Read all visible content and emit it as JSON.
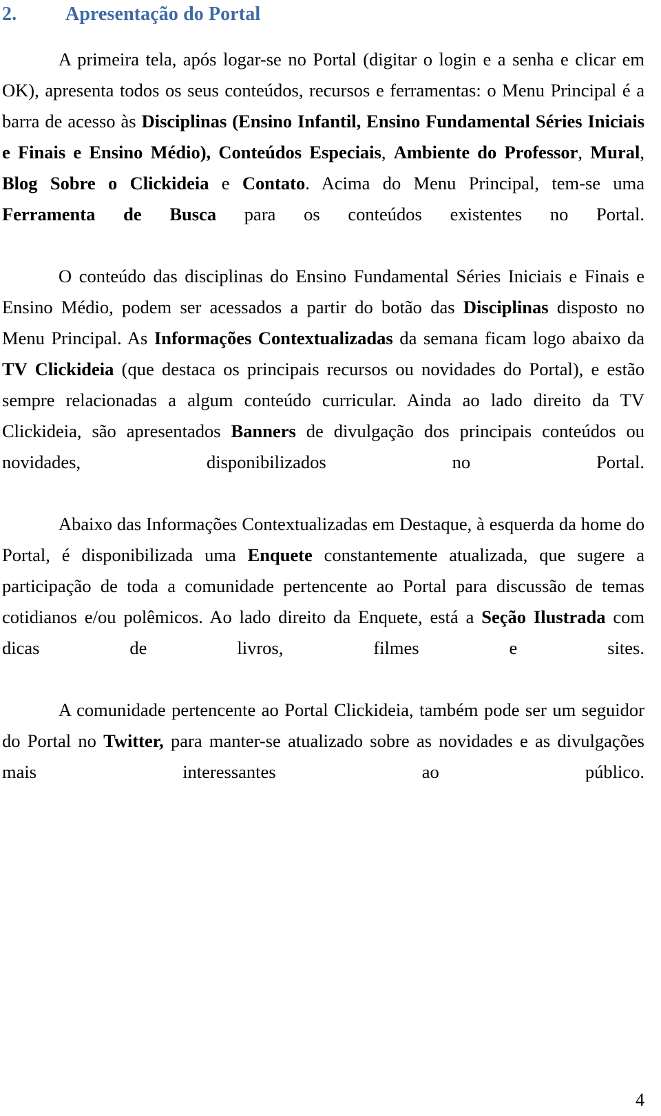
{
  "document": {
    "heading": {
      "number": "2.",
      "title": "Apresentação do Portal",
      "color": "#3f6aa3"
    },
    "paragraphs": [
      {
        "id": "para-1",
        "runs": [
          {
            "text": "A primeira tela, após logar-se no Portal (digitar o login e a senha e clicar em OK), apresenta todos os seus conteúdos, recursos e ferramentas: o Menu Principal é a barra de acesso às ",
            "bold": false
          },
          {
            "text": "Disciplinas (Ensino Infantil, Ensino Fundamental Séries Iniciais e Finais e Ensino Médio), Conteúdos Especiais",
            "bold": true
          },
          {
            "text": ", ",
            "bold": false
          },
          {
            "text": "Ambiente do Professor",
            "bold": true
          },
          {
            "text": ", ",
            "bold": false
          },
          {
            "text": "Mural",
            "bold": true
          },
          {
            "text": ", ",
            "bold": false
          },
          {
            "text": "Blog Sobre o Clickideia",
            "bold": true
          },
          {
            "text": " e ",
            "bold": false
          },
          {
            "text": "Contato",
            "bold": true
          },
          {
            "text": ". Acima do Menu Principal, tem-se uma ",
            "bold": false
          },
          {
            "text": "Ferramenta de Busca",
            "bold": true
          },
          {
            "text": " para os conteúdos existentes no Portal.",
            "bold": false
          }
        ]
      },
      {
        "id": "para-2",
        "runs": [
          {
            "text": "O conteúdo das disciplinas do Ensino Fundamental Séries Iniciais e Finais e Ensino Médio, podem ser acessados a partir do botão das ",
            "bold": false
          },
          {
            "text": "Disciplinas",
            "bold": true
          },
          {
            "text": " disposto no Menu Principal. As ",
            "bold": false
          },
          {
            "text": "Informações Contextualizadas",
            "bold": true
          },
          {
            "text": " da semana ficam logo abaixo da ",
            "bold": false
          },
          {
            "text": "TV Clickideia",
            "bold": true
          },
          {
            "text": " (que destaca os principais recursos ou novidades do Portal), e estão sempre relacionadas a algum conteúdo curricular. Ainda ao lado direito da TV Clickideia, são apresentados ",
            "bold": false
          },
          {
            "text": "Banners",
            "bold": true
          },
          {
            "text": " de divulgação dos principais conteúdos ou novidades, disponibilizados no Portal.",
            "bold": false
          }
        ]
      },
      {
        "id": "para-3",
        "runs": [
          {
            "text": "Abaixo das Informações Contextualizadas em Destaque, à esquerda da home do Portal, é disponibilizada uma ",
            "bold": false
          },
          {
            "text": "Enquete",
            "bold": true
          },
          {
            "text": " constantemente atualizada, que sugere a participação de toda a comunidade pertencente ao Portal para discussão de temas cotidianos e/ou polêmicos. Ao lado direito da Enquete, está a ",
            "bold": false
          },
          {
            "text": "Seção Ilustrada",
            "bold": true
          },
          {
            "text": " com dicas de livros, filmes e sites.",
            "bold": false
          }
        ]
      },
      {
        "id": "para-4",
        "runs": [
          {
            "text": "A comunidade pertencente ao Portal Clickideia, também pode ser um seguidor do Portal no ",
            "bold": false
          },
          {
            "text": "Twitter,",
            "bold": true
          },
          {
            "text": " para manter-se atualizado sobre as novidades e as divulgações mais interessantes ao público.",
            "bold": false
          }
        ]
      }
    ],
    "footer": {
      "page_number": "4"
    }
  }
}
